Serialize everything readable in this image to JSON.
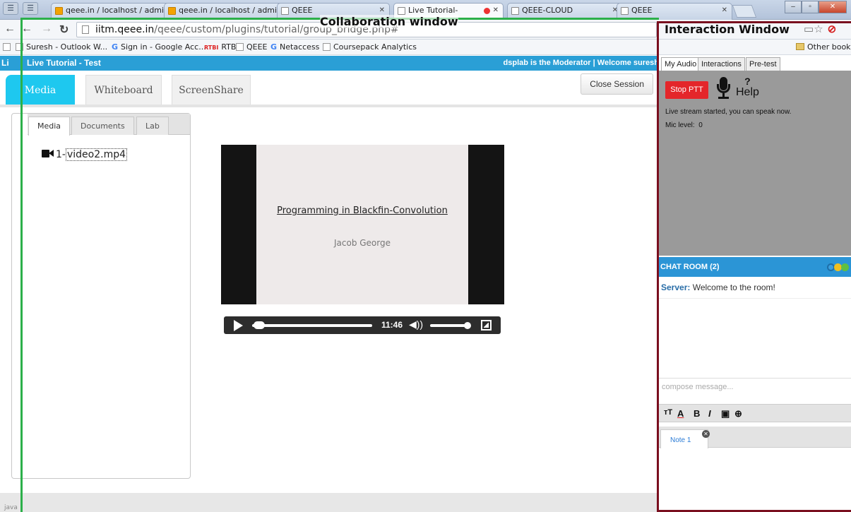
{
  "browser": {
    "tabs": [
      {
        "title": "qeee.in / localhost / admi",
        "icon": "phpmyadmin-icon"
      },
      {
        "title": "qeee.in / localhost / admi",
        "icon": "phpmyadmin-icon"
      },
      {
        "title": "QEEE",
        "icon": "page-icon"
      },
      {
        "title": "Live Tutorial-",
        "icon": "page-icon",
        "active": true,
        "recording": true
      },
      {
        "title": "QEEE-CLOUD",
        "icon": "page-icon"
      },
      {
        "title": "QEEE",
        "icon": "page-icon"
      }
    ],
    "url_host": "iitm.qeee.in",
    "url_path": "/qeee/custom/plugins/tutorial/group_bridge.php#",
    "bookmarks": [
      {
        "label": "Suresh - Outlook W...",
        "icon": "outlook-icon"
      },
      {
        "label": "Sign in - Google Acc...",
        "icon": "google-icon"
      },
      {
        "label": "RTBI",
        "icon": "rtbi-icon"
      },
      {
        "label": "QEEE",
        "icon": "page-icon"
      },
      {
        "label": "Netaccess",
        "icon": "google-icon"
      },
      {
        "label": "Coursepack Analytics",
        "icon": "page-icon"
      }
    ],
    "other_bookmarks": "Other bookm",
    "status_text": "java"
  },
  "app": {
    "title": "Live Tutorial -  Test",
    "title_prefix": "Li",
    "moderator_text": "dsplab is the Moderator | Welcome suresh",
    "main_tabs": [
      "Media",
      "Whiteboard",
      "ScreenShare"
    ],
    "active_main_tab": "Media",
    "close_session": "Close Session"
  },
  "left_panel": {
    "tabs": [
      "Media",
      "Documents",
      "Lab"
    ],
    "active_tab": "Media",
    "file_index": "1-",
    "file_name": "video2.mp4"
  },
  "video": {
    "slide_title": "Programming in Blackfin-Convolution",
    "slide_author": "Jacob George",
    "time": "11:46"
  },
  "interaction": {
    "tabs": [
      "My Audio",
      "Interactions",
      "Pre-test"
    ],
    "active_tab": "My Audio",
    "stop_ptt": "Stop PTT",
    "help": "Help",
    "live_status": "Live stream started, you can speak now.",
    "mic_level_label": "Mic level:",
    "mic_level_value": "0",
    "chat_title": "CHAT ROOM",
    "chat_count": "(2)",
    "chat_messages": [
      {
        "sender": "Server:",
        "text": "Welcome to the room!"
      }
    ],
    "compose_placeholder": "compose message...",
    "note_tab": "Note 1"
  },
  "annotations": {
    "collaboration": "Collaboration window",
    "interaction": "Interaction Window",
    "collaboration_color": "#2cb04a",
    "interaction_color": "#7a0f1f"
  }
}
